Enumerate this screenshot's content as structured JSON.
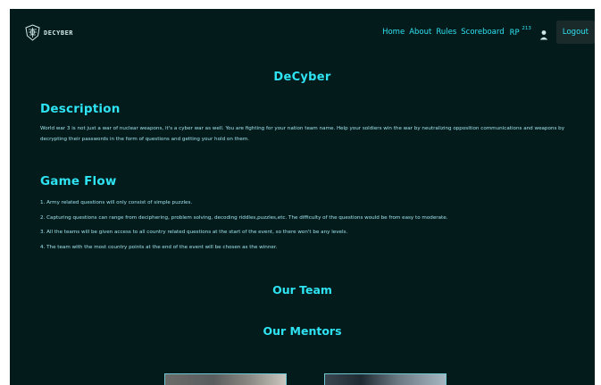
{
  "nav": {
    "logo_text": "DECYBER",
    "links": [
      "Home",
      "About",
      "Rules",
      "Scoreboard"
    ],
    "rp_label": "RP",
    "rp_value": "213",
    "logout_label": "Logout"
  },
  "main": {
    "title": "DeCyber",
    "description": {
      "heading": "Description",
      "text": "World war 3 is not just a war of nuclear weapons, it's a cyber war as well. You are fighting for your nation team name. Help your soldiers win the war by neutralizing opposition communications and weapons by decrypting their passwords in the form of questions and getting your hold on them."
    },
    "game_flow": {
      "heading": "Game Flow",
      "items": [
        "1. Army related questions will only consist of simple puzzles.",
        "2. Capturing questions can range from deciphering, problem solving, decoding riddles,puzzles,etc. The difficulty of the questions would be from easy to moderate.",
        "3. All the teams will be given access to all country related questions at the start of the event, so there won't be any levels.",
        "4. The team with the most country points at the end of the event will be chosen as the winner."
      ]
    },
    "team_heading": "Our Team",
    "mentors_heading": "Our Mentors"
  },
  "icons": {
    "logo": "shield-logo-icon",
    "user": "user-icon"
  },
  "colors": {
    "background": "#041b1c",
    "accent": "#2ee3f2",
    "body_text": "#9fe4ec",
    "logout_bg": "#1a2a2b"
  }
}
